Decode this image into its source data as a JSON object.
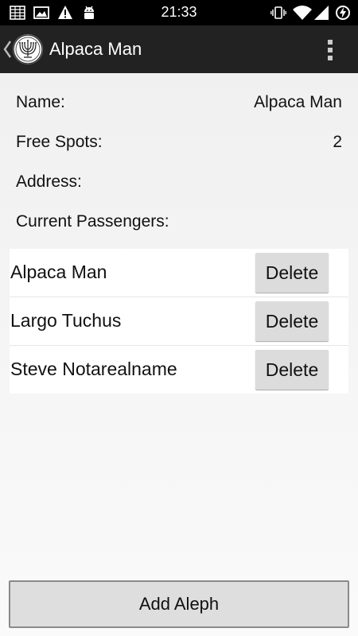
{
  "status_bar": {
    "time": "21:33",
    "left_icons": [
      "grid-notification-icon",
      "image-notification-icon",
      "warning-icon",
      "android-debug-icon"
    ],
    "right_icons": [
      "vibrate-icon",
      "wifi-icon",
      "cell-signal-icon",
      "data-saver-icon"
    ]
  },
  "action_bar": {
    "title": "Alpaca Man",
    "background": "#222222"
  },
  "details": {
    "name_label": "Name:",
    "name_value": "Alpaca Man",
    "free_spots_label": "Free Spots:",
    "free_spots_value": "2",
    "address_label": "Address:",
    "address_value": "",
    "passengers_label": "Current Passengers:"
  },
  "passengers": [
    {
      "name": "Alpaca Man",
      "action": "Delete"
    },
    {
      "name": "Largo Tuchus",
      "action": "Delete"
    },
    {
      "name": "Steve Notarealname",
      "action": "Delete"
    }
  ],
  "footer": {
    "add_label": "Add Aleph"
  }
}
